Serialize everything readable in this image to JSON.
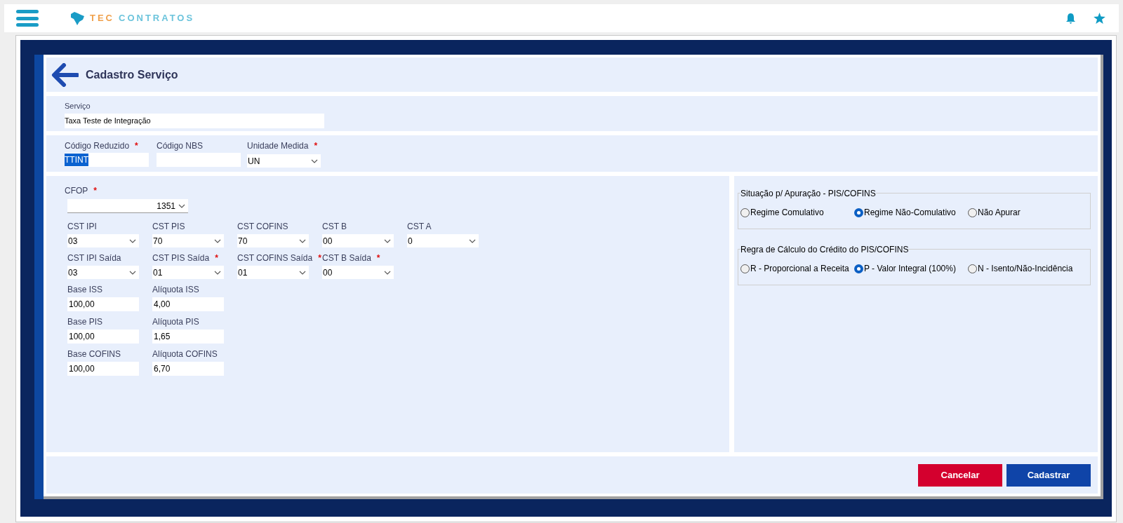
{
  "topbar": {
    "brand_part_1": "TEC",
    "brand_part_2": "CONTRATOS"
  },
  "header": {
    "title": "Cadastro Serviço"
  },
  "service": {
    "label": "Serviço",
    "value": "Taxa Teste de Integração"
  },
  "codes": [
    {
      "label": "Código Reduzido",
      "required_mark": "*",
      "kind": "text",
      "value": "TTINT",
      "text_selected": true
    },
    {
      "label": "Código NBS",
      "kind": "text"
    },
    {
      "label": "Unidade Medida",
      "required_mark": "*",
      "kind": "select",
      "value": "UN"
    }
  ],
  "cfop": {
    "label": "CFOP",
    "required_mark": "*",
    "value": "1351"
  },
  "tax_rows": [
    [
      {
        "label": "CST IPI",
        "kind": "select",
        "value": "03"
      },
      {
        "label": "CST PIS",
        "kind": "select",
        "value": "70"
      },
      {
        "label": "CST COFINS",
        "kind": "select",
        "value": "70"
      },
      {
        "label": "CST B",
        "kind": "select",
        "value": "00"
      },
      {
        "label": "CST A",
        "kind": "select",
        "value": "0"
      }
    ],
    [
      {
        "label": "CST IPI Saída",
        "kind": "select",
        "value": "03"
      },
      {
        "label": "CST PIS Saída",
        "required_mark": "*",
        "kind": "select",
        "value": "01"
      },
      {
        "label": "CST COFINS Saída",
        "required_mark": "*",
        "kind": "select",
        "value": "01"
      },
      {
        "label": "CST B Saída",
        "required_mark": "*",
        "kind": "select",
        "value": "00"
      }
    ],
    [
      {
        "label": "Base ISS",
        "kind": "text",
        "value": "100,00"
      },
      {
        "label": "Alíquota ISS",
        "kind": "text",
        "value": "4,00"
      }
    ],
    [
      {
        "label": "Base PIS",
        "kind": "text",
        "value": "100,00"
      },
      {
        "label": "Alíquota PIS",
        "kind": "text",
        "value": "1,65"
      }
    ],
    [
      {
        "label": "Base COFINS",
        "kind": "text",
        "value": "100,00"
      },
      {
        "label": "Alíquota COFINS",
        "kind": "text",
        "value": "6,70"
      }
    ]
  ],
  "radio_groups": [
    {
      "title": "Situação p/ Apuração - PIS/COFINS",
      "options": [
        {
          "label": "Regime Comulativo",
          "selected": false
        },
        {
          "label": "Regime Não-Comulativo",
          "selected": true
        },
        {
          "label": "Não Apurar",
          "selected": false
        }
      ]
    },
    {
      "title": "Regra de Cálculo do Crédito do PIS/COFINS",
      "options": [
        {
          "label": "R - Proporcional a Receita",
          "selected": false
        },
        {
          "label": "P - Valor Integral (100%)",
          "selected": true
        },
        {
          "label": "N - Isento/Não-Incidência",
          "selected": false
        }
      ]
    }
  ],
  "buttons": [
    {
      "label": "Cancelar",
      "kind": "cancel"
    },
    {
      "label": "Cadastrar",
      "kind": "submit"
    }
  ]
}
